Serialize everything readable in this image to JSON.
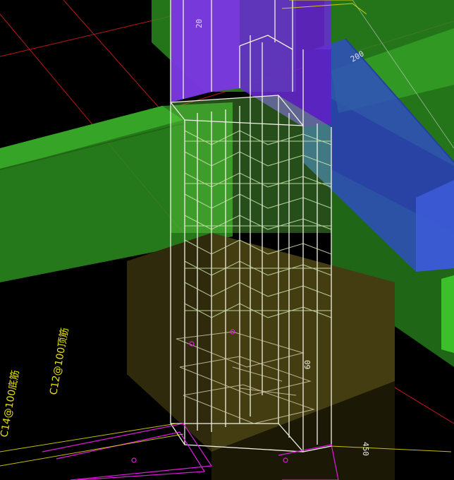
{
  "colors": {
    "background": "#000000",
    "beam_green": "#2a8a1e",
    "beam_green_dark": "#1f6615",
    "column_upper_purple": "#6a2bd6",
    "beam_blue": "#2f4fc0",
    "foundation_brown": "#3a3410",
    "rebar_white": "#f2f2e6",
    "rebar_light_green": "#b9f07a",
    "grid_red": "#d11a1a",
    "annotation_yellow": "#e6e000",
    "outline_magenta": "#e01adf"
  },
  "annotations": {
    "dim_top": "20",
    "dim_right": "200",
    "dim_mid": "09",
    "dim_bottom": "450",
    "rebar_note_1": "C14@100底筋",
    "rebar_note_2": "C12@100顶筋"
  }
}
